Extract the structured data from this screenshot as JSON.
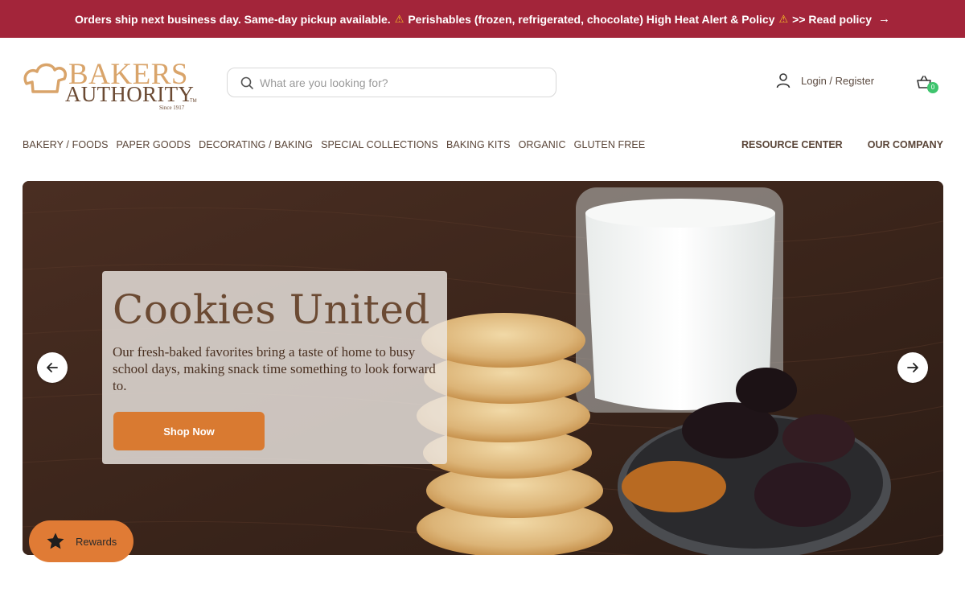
{
  "announcement": {
    "part1": "Orders ship next business day. Same-day pickup available.",
    "part2": "Perishables (frozen, refrigerated, chocolate) High Heat Alert & Policy",
    "link": ">> Read policy",
    "warning_icon": "warning-icon",
    "arrow_icon": "arrow-right-icon"
  },
  "logo": {
    "line1": "BAKERS",
    "line2": "AUTHORITY",
    "tm": "TM",
    "since": "Since 1917"
  },
  "search": {
    "placeholder": "What are you looking for?",
    "icon": "search-icon"
  },
  "account": {
    "label": "Login / Register",
    "icon": "user-icon"
  },
  "cart": {
    "count": "0",
    "icon": "basket-icon"
  },
  "nav": {
    "items": [
      "BAKERY / FOODS",
      "PAPER GOODS",
      "DECORATING / BAKING",
      "SPECIAL COLLECTIONS",
      "BAKING KITS",
      "ORGANIC",
      "GLUTEN FREE"
    ],
    "right": [
      "RESOURCE CENTER",
      "OUR COMPANY"
    ]
  },
  "hero": {
    "title": "Cookies United",
    "text": "Our fresh-baked favorites bring a taste of home to busy school days, making snack time something to look forward to.",
    "button": "Shop Now",
    "prev_icon": "arrow-left-icon",
    "next_icon": "arrow-right-icon"
  },
  "rewards": {
    "label": "Rewards",
    "icon": "star-icon"
  },
  "colors": {
    "announce_bg": "#a3253a",
    "accent": "#d97a31",
    "logo": "#d9a46a",
    "text": "#5a4538"
  }
}
